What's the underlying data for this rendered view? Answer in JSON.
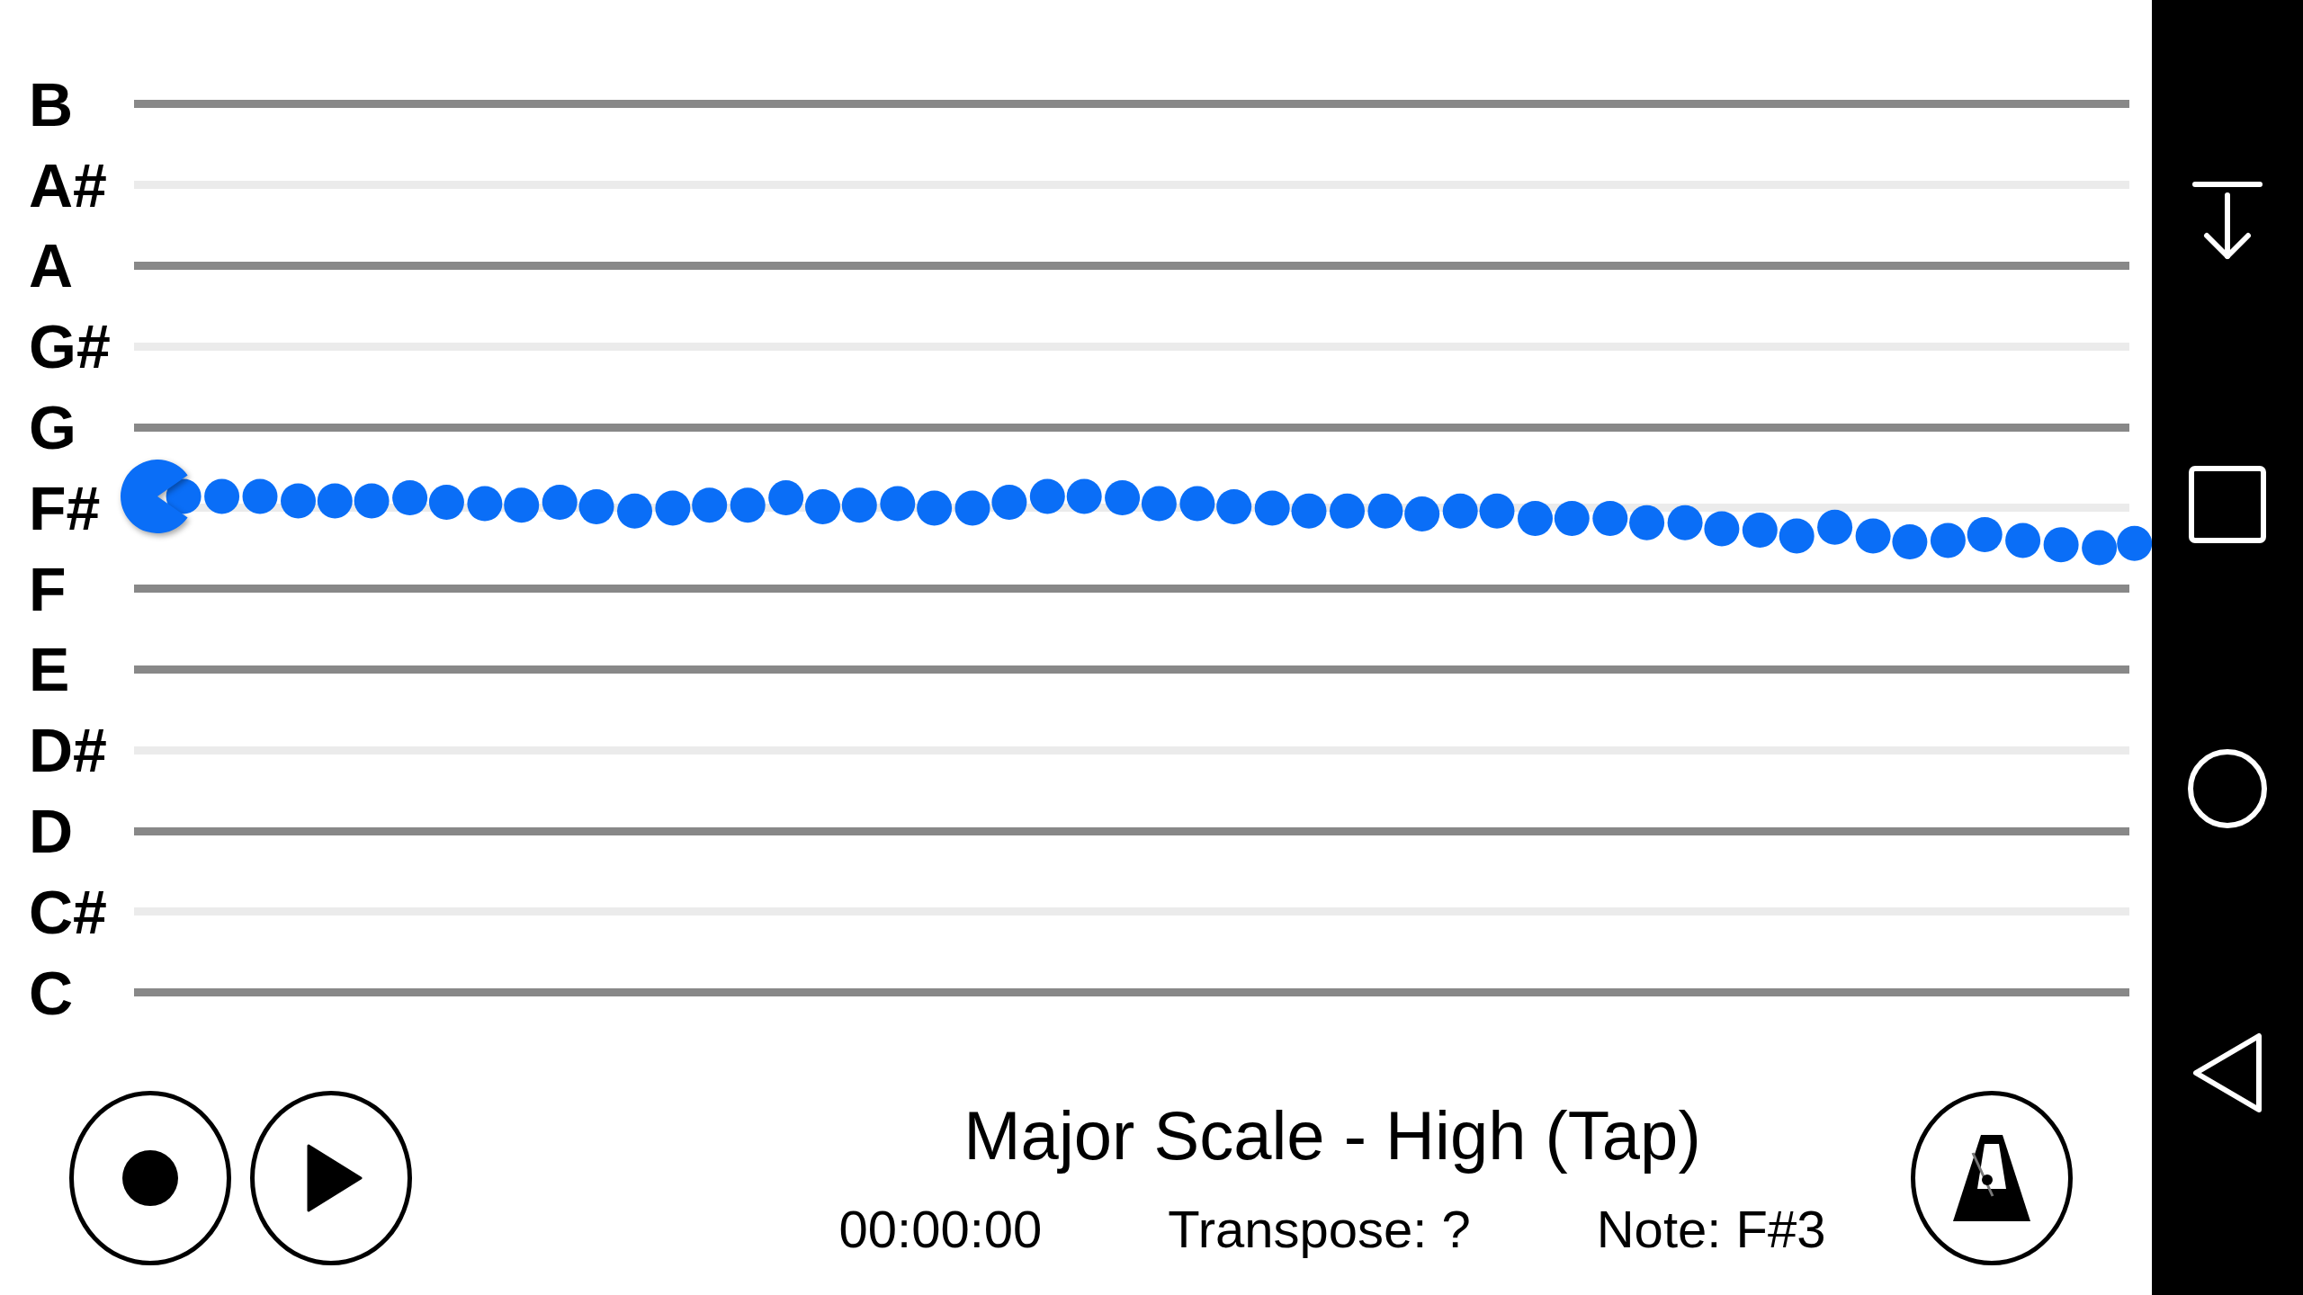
{
  "staff": {
    "notes": [
      {
        "label": "B",
        "kind": "natural"
      },
      {
        "label": "A#",
        "kind": "sharp"
      },
      {
        "label": "A",
        "kind": "natural"
      },
      {
        "label": "G#",
        "kind": "sharp"
      },
      {
        "label": "G",
        "kind": "natural"
      },
      {
        "label": "F#",
        "kind": "sharp"
      },
      {
        "label": "F",
        "kind": "natural"
      },
      {
        "label": "E",
        "kind": "natural"
      },
      {
        "label": "D#",
        "kind": "sharp"
      },
      {
        "label": "D",
        "kind": "natural"
      },
      {
        "label": "C#",
        "kind": "sharp"
      },
      {
        "label": "C",
        "kind": "natural"
      }
    ]
  },
  "exercise": {
    "title": "Major Scale - High (Tap)",
    "timer": "00:00:00",
    "transpose": "Transpose: ?",
    "note": "Note: F#3"
  }
}
